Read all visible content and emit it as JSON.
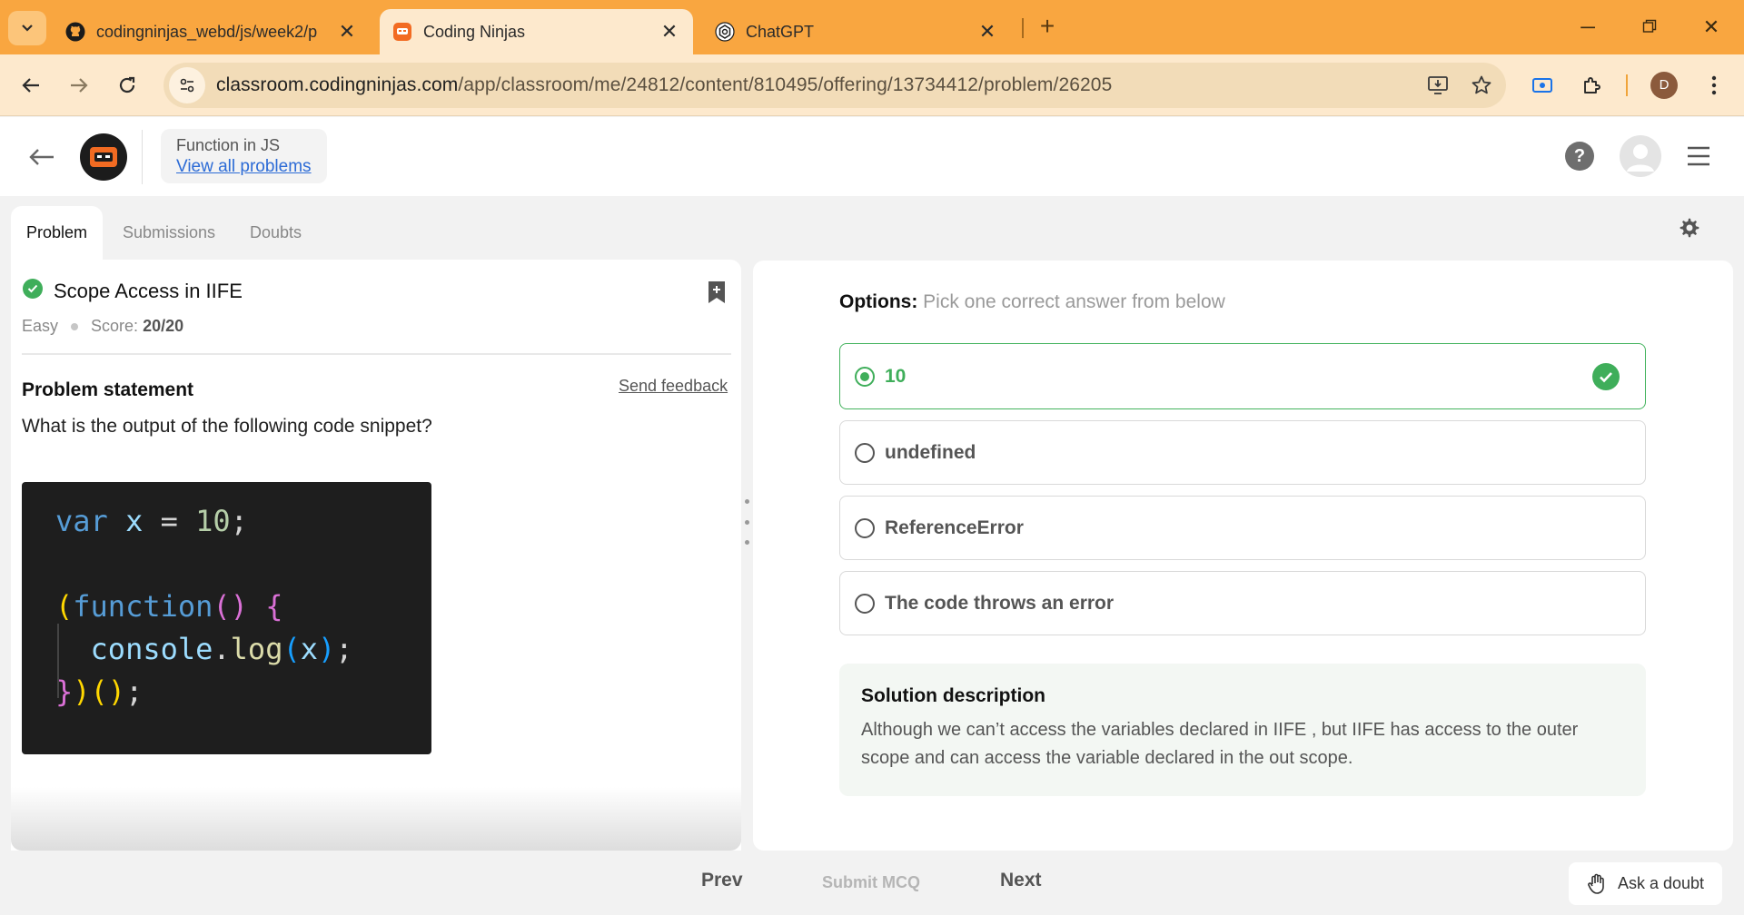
{
  "browser": {
    "tabs": [
      {
        "title": "codingninjas_webd/js/week2/p",
        "icon": "github-icon"
      },
      {
        "title": "Coding Ninjas",
        "icon": "coding-ninjas-icon"
      },
      {
        "title": "ChatGPT",
        "icon": "chatgpt-icon"
      }
    ],
    "url_host": "classroom.codingninjas.com",
    "url_path": "/app/classroom/me/24812/content/810495/offering/13734412/problem/26205",
    "profile_initial": "D"
  },
  "header": {
    "course": "Function in JS",
    "view_all": "View all problems"
  },
  "tabs": [
    "Problem",
    "Submissions",
    "Doubts"
  ],
  "problem": {
    "title": "Scope Access in IIFE",
    "difficulty": "Easy",
    "score_label": "Score:",
    "score": "20/20",
    "statement_heading": "Problem statement",
    "feedback": "Send feedback",
    "question": "What is the output of the following code snippet?"
  },
  "options": {
    "heading": "Options:",
    "instruction": "Pick one correct answer from below",
    "items": [
      {
        "label": "10",
        "selected": true,
        "correct": true
      },
      {
        "label": "undefined",
        "selected": false
      },
      {
        "label": "ReferenceError",
        "selected": false
      },
      {
        "label": "The code throws an error",
        "selected": false
      }
    ]
  },
  "solution": {
    "heading": "Solution description",
    "text": "Although we can’t access the variables declared in IIFE , but IIFE has access to the outer scope and can access the variable declared in the out scope."
  },
  "footer": {
    "prev": "Prev",
    "submit": "Submit MCQ",
    "next": "Next",
    "ask": "Ask a doubt"
  },
  "colors": {
    "tabstrip": "#f9a640",
    "toolbar": "#fde9cd",
    "success": "#3fae5a",
    "link": "#2c6bd6"
  }
}
